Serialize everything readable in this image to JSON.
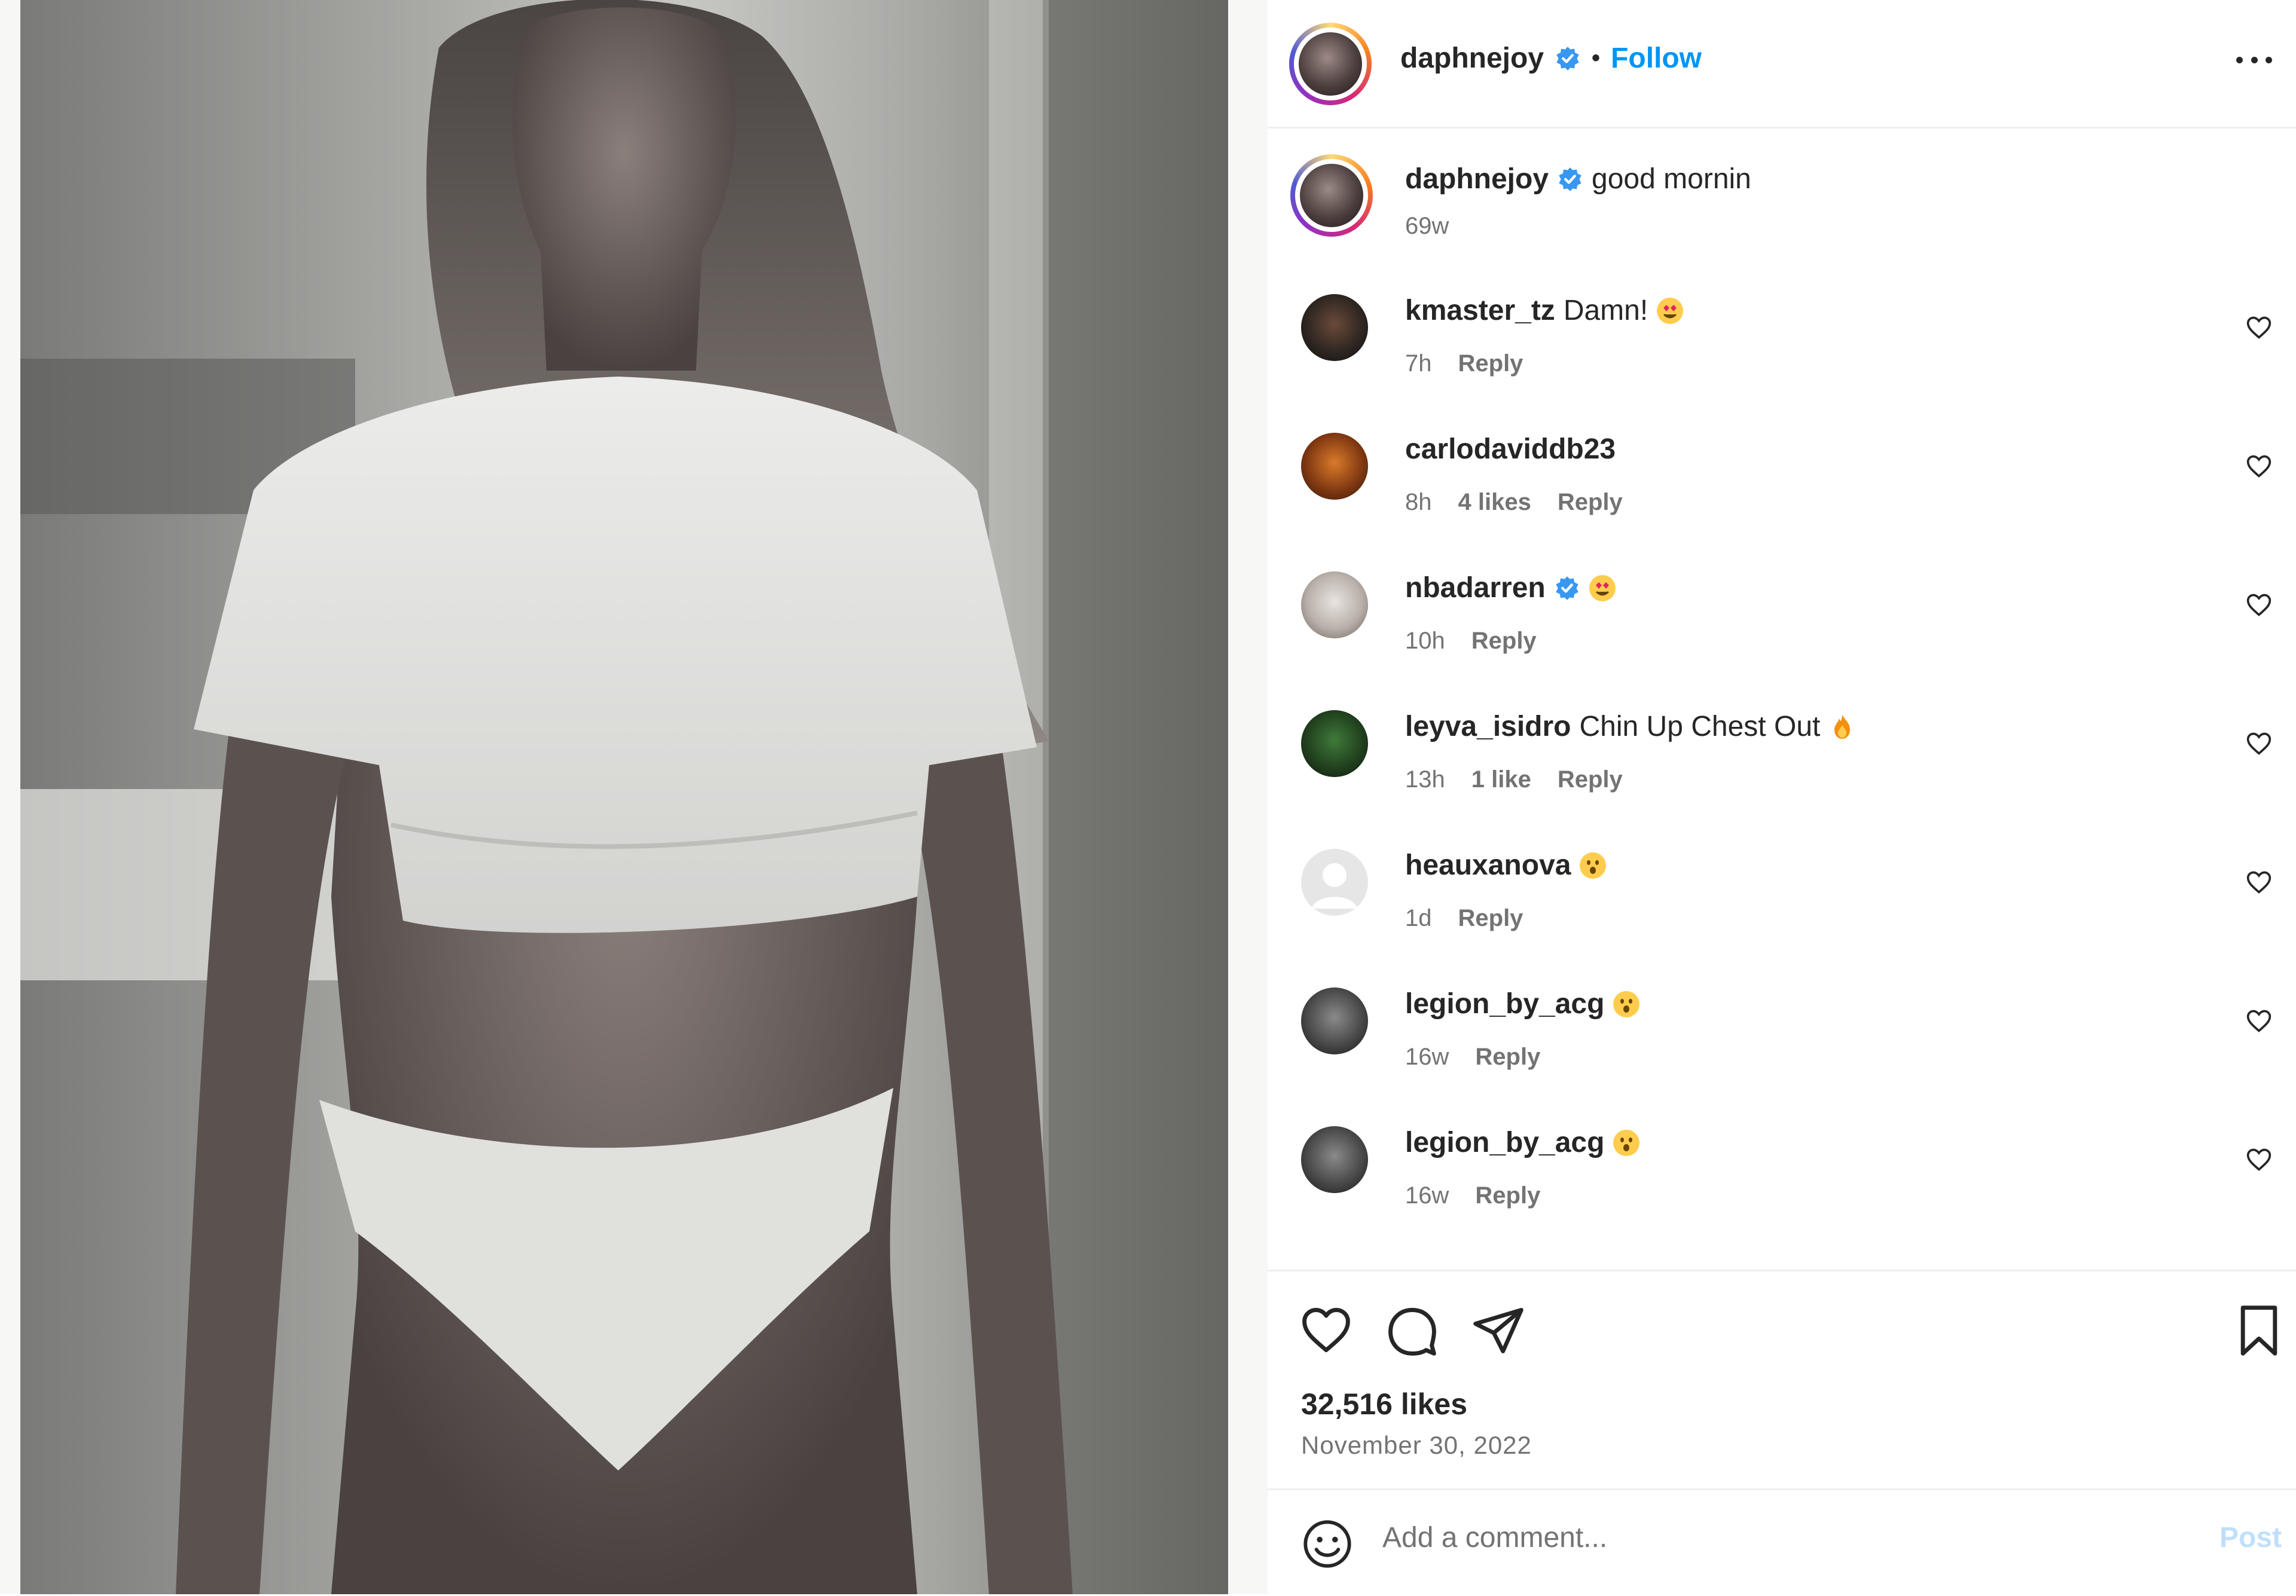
{
  "post": {
    "author": "daphnejoy",
    "follow_label": "Follow",
    "separator": "•",
    "caption_text": "good mornin",
    "caption_age": "69w",
    "likes": "32,516 likes",
    "date": "November 30, 2022"
  },
  "comments": [
    {
      "user": "kmaster_tz",
      "text": "Damn!",
      "emoji": "heart-eyes",
      "age": "7h",
      "likes": "",
      "reply": "Reply"
    },
    {
      "user": "carlodaviddb23",
      "text": "",
      "emoji": "",
      "age": "8h",
      "likes": "4 likes",
      "reply": "Reply"
    },
    {
      "user": "nbadarren",
      "text": "",
      "emoji": "heart-eyes",
      "verified": true,
      "age": "10h",
      "likes": "",
      "reply": "Reply"
    },
    {
      "user": "leyva_isidro",
      "text": "Chin Up Chest Out",
      "emoji": "fire",
      "age": "13h",
      "likes": "1 like",
      "reply": "Reply"
    },
    {
      "user": "heauxanova",
      "text": "",
      "emoji": "surprised",
      "age": "1d",
      "likes": "",
      "reply": "Reply"
    },
    {
      "user": "legion_by_acg",
      "text": "",
      "emoji": "surprised",
      "age": "16w",
      "likes": "",
      "reply": "Reply"
    },
    {
      "user": "legion_by_acg",
      "text": "",
      "emoji": "surprised",
      "age": "16w",
      "likes": "",
      "reply": "Reply"
    }
  ],
  "comment_box": {
    "placeholder": "Add a comment...",
    "post_label": "Post"
  },
  "icons": {
    "like": "heart-icon",
    "comment": "comment-bubble-icon",
    "share": "paper-plane-icon",
    "save": "bookmark-icon",
    "emoji": "smiley-icon",
    "more": "more-options-icon",
    "verified": "verified-badge-icon"
  },
  "colors": {
    "follow": "#0095f6",
    "verified": "#3897f0",
    "muted": "#737373",
    "post_disabled": "#c0dffd"
  }
}
